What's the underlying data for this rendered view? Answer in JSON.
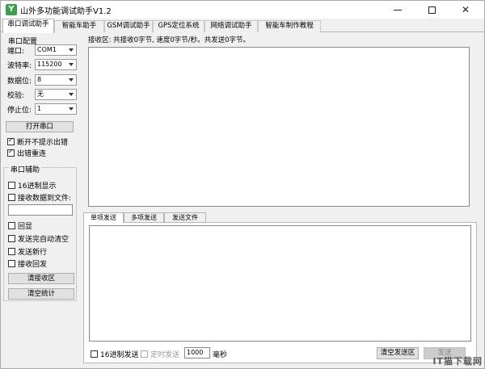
{
  "window": {
    "title": "山外多功能调试助手V1.2",
    "icon_letter": "Y"
  },
  "tabs": [
    "串口调试助手",
    "智能车助手",
    "GSM调试助手",
    "GPS定位系统",
    "网络调试助手",
    "智能车制作教程"
  ],
  "serial_config": {
    "title": "串口配置",
    "port_label": "端口:",
    "port_value": "COM1",
    "baud_label": "波特率:",
    "baud_value": "115200",
    "databits_label": "数据位:",
    "databits_value": "8",
    "parity_label": "校验:",
    "parity_value": "无",
    "stopbits_label": "停止位:",
    "stopbits_value": "1",
    "open_button": "打开串口",
    "no_error_prompt": "断开不提示出错",
    "reconnect_on_error": "出错重连"
  },
  "serial_aux": {
    "title": "串口辅助",
    "hex_display": "16进制显示",
    "receive_to_file": "接收数据到文件:",
    "echo": "回显",
    "auto_clear_after_send": "发送完自动清空",
    "send_newline": "发送新行",
    "receive_echo": "接收回发",
    "clear_receive_button": "清接收区",
    "clear_stats_button": "清空统计"
  },
  "receive": {
    "status": "接收区: 共接收0字节, 速度0字节/秒。共发送0字节。"
  },
  "send_tabs": [
    "单项发送",
    "多项发送",
    "发送文件"
  ],
  "send_bar": {
    "hex_send": "16进制发送",
    "timed_send": "定时发送",
    "interval_value": "1000",
    "unit": "毫秒",
    "clear_send_button": "清空发送区",
    "send_button": "发送"
  },
  "watermark": "IT猫下载网"
}
